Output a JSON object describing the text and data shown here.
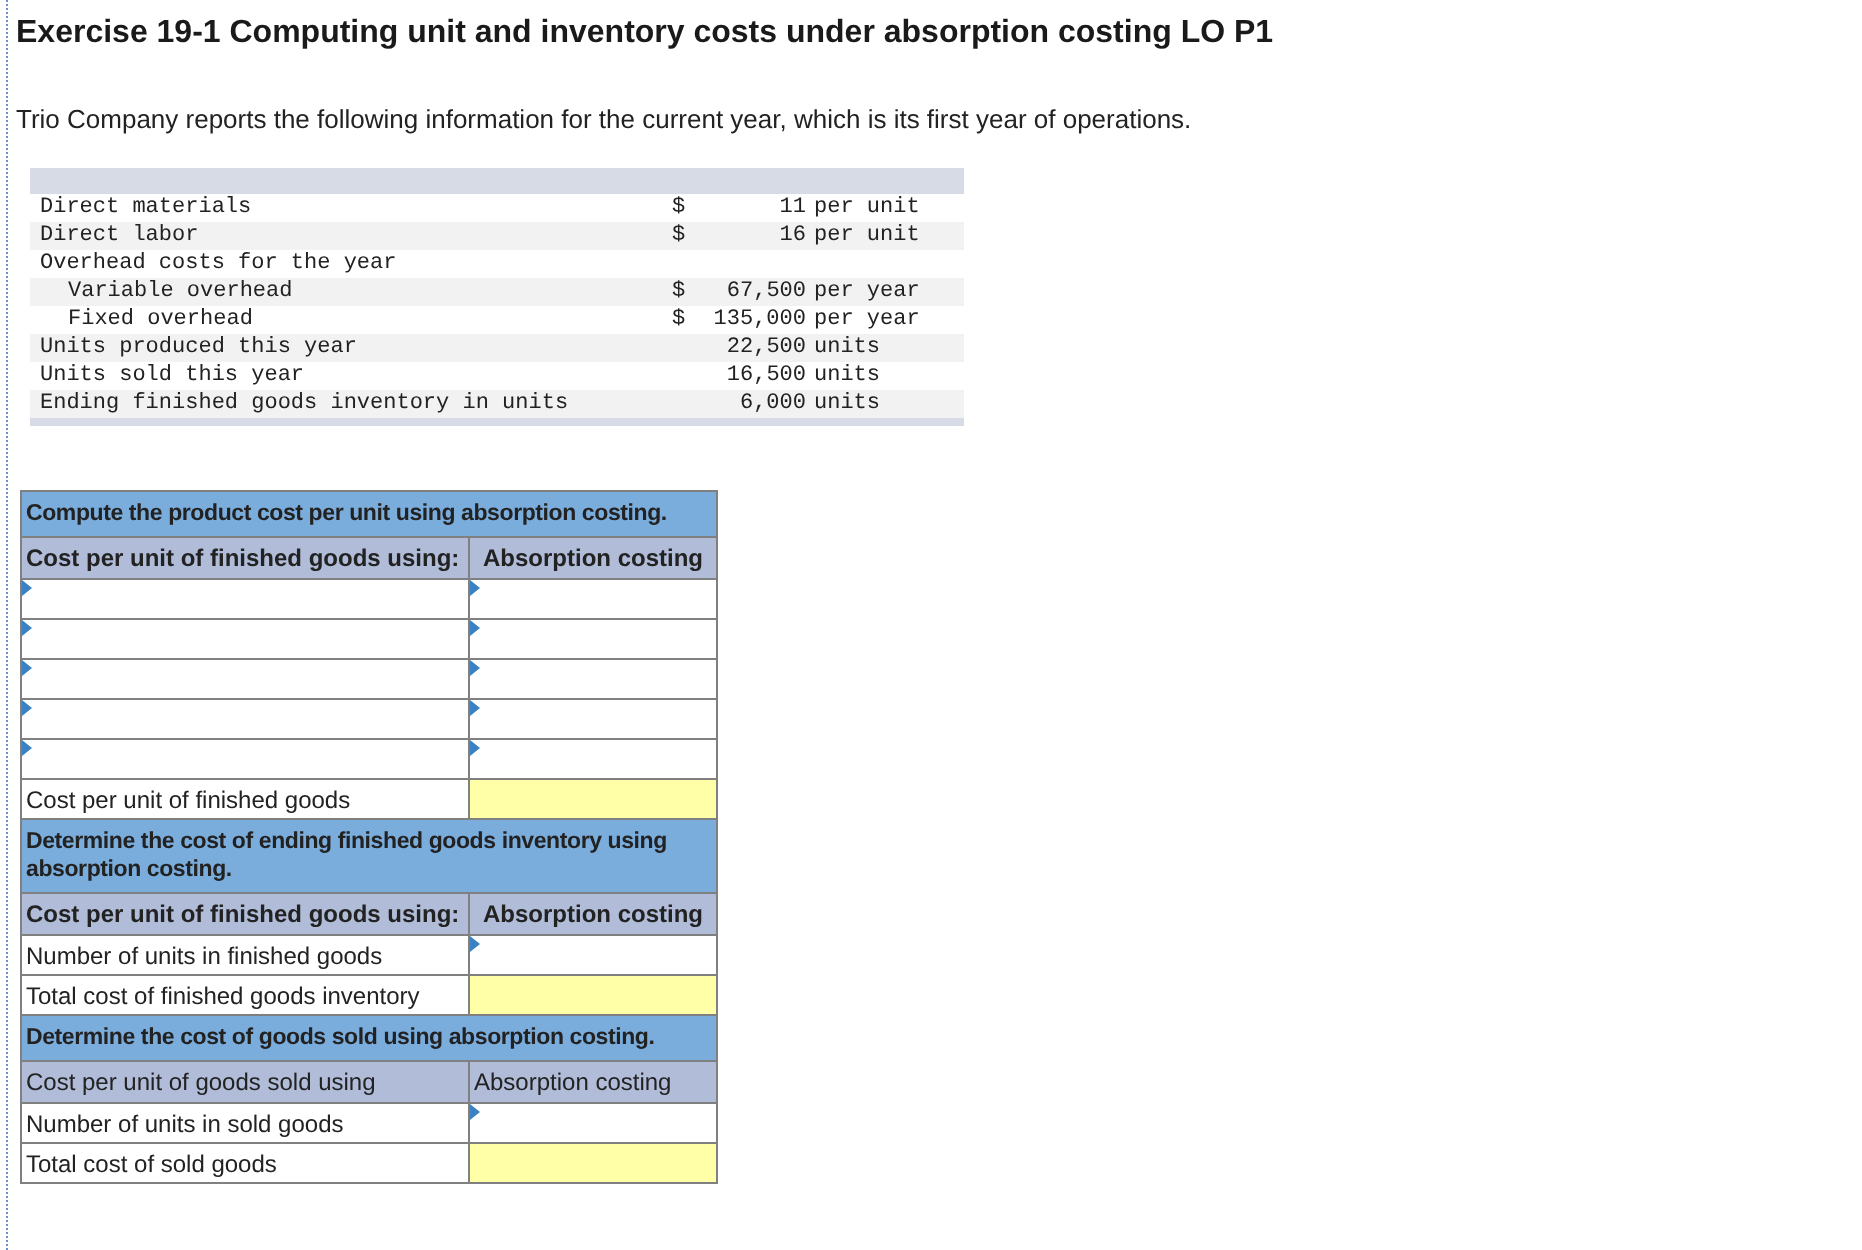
{
  "title": "Exercise 19-1 Computing unit and inventory costs under absorption costing LO P1",
  "intro": "Trio Company reports the following information for the current year, which is its first year of operations.",
  "info_rows": [
    {
      "label": "Direct materials",
      "indented": false,
      "dollar": "$",
      "amount": "11",
      "unit": "per unit"
    },
    {
      "label": "Direct labor",
      "indented": false,
      "dollar": "$",
      "amount": "16",
      "unit": "per unit"
    },
    {
      "label": "Overhead costs for the year",
      "indented": false
    },
    {
      "label": "Variable overhead",
      "indented": true,
      "dollar": "$",
      "amount": "67,500",
      "unit": "per year"
    },
    {
      "label": "Fixed overhead",
      "indented": true,
      "dollar": "$",
      "amount": "135,000",
      "unit": "per year"
    },
    {
      "label": "Units produced this year",
      "indented": false,
      "amount": "22,500",
      "unit": "units"
    },
    {
      "label": "Units sold this year",
      "indented": false,
      "amount": "16,500",
      "unit": "units"
    },
    {
      "label": "Ending finished goods inventory in units",
      "indented": false,
      "amount": "6,000",
      "unit": "units"
    }
  ],
  "sections": [
    {
      "title": "Compute the product cost per unit using absorption costing.",
      "header": {
        "bold": true,
        "column_1": "Cost per unit of finished goods using:",
        "column_2": "Absorption costing"
      },
      "rows": [
        {
          "kind": "select_pair"
        },
        {
          "kind": "select_pair"
        },
        {
          "kind": "select_pair"
        },
        {
          "kind": "select_pair"
        },
        {
          "kind": "select_pair"
        },
        {
          "kind": "total",
          "label": "Cost per unit of finished goods"
        }
      ]
    },
    {
      "title": "Determine the cost of ending finished goods inventory using absorption costing.",
      "header": {
        "bold": true,
        "column_1": "Cost per unit of finished goods using:",
        "column_2": "Absorption costing"
      },
      "rows": [
        {
          "kind": "input",
          "label": "Number of units in finished goods"
        },
        {
          "kind": "total",
          "label": "Total cost of finished goods inventory"
        }
      ]
    },
    {
      "title": "Determine the cost of goods sold using absorption costing.",
      "header": {
        "bold": false,
        "column_1": "Cost per unit of goods sold using",
        "column_2": "Absorption costing"
      },
      "rows": [
        {
          "kind": "input",
          "label": "Number of units in sold goods"
        },
        {
          "kind": "total",
          "label": "Total cost of sold goods"
        }
      ]
    }
  ]
}
